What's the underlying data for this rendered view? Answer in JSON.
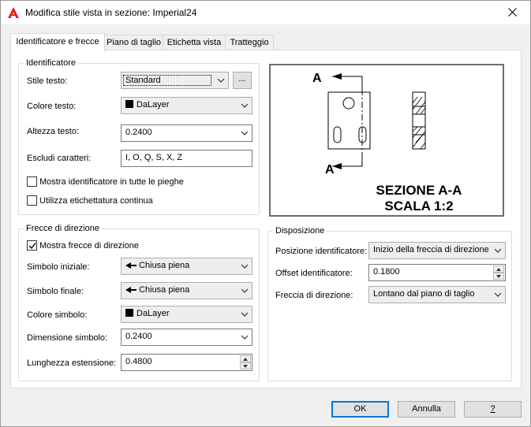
{
  "window": {
    "title": "Modifica stile vista in sezione: Imperial24"
  },
  "tabs": [
    {
      "label": "Identificatore e frecce"
    },
    {
      "label": "Piano di taglio"
    },
    {
      "label": "Etichetta vista"
    },
    {
      "label": "Tratteggio"
    }
  ],
  "identifier": {
    "group_title": "Identificatore",
    "text_style_label": "Stile testo:",
    "text_style_value": "Standard",
    "browse_label": "...",
    "text_color_label": "Colore testo:",
    "text_color_value": "DaLayer",
    "text_height_label": "Altezza testo:",
    "text_height_value": "0.2400",
    "exclude_label": "Escludi caratteri:",
    "exclude_value": "I, O, Q, S, X, Z",
    "show_all_bends_label": "Mostra identificatore in tutte le pieghe",
    "continuous_label": "Utilizza etichettatura continua"
  },
  "arrows": {
    "group_title": "Frecce di direzione",
    "show_arrows_label": "Mostra frecce di direzione",
    "start_symbol_label": "Simbolo iniziale:",
    "start_symbol_value": "Chiusa piena",
    "end_symbol_label": "Simbolo finale:",
    "end_symbol_value": "Chiusa piena",
    "symbol_color_label": "Colore simbolo:",
    "symbol_color_value": "DaLayer",
    "symbol_size_label": "Dimensione simbolo:",
    "symbol_size_value": "0.2400",
    "extension_label": "Lunghezza estensione:",
    "extension_value": "0.4800"
  },
  "layout": {
    "group_title": "Disposizione",
    "position_label": "Posizione identificatore:",
    "position_value": "Inizio della freccia di direzione",
    "offset_label": "Offset identificatore:",
    "offset_value": "0.1800",
    "direction_label": "Freccia di direzione:",
    "direction_value": "Lontano dal piano di taglio"
  },
  "preview": {
    "letter": "A",
    "caption_line1": "SEZIONE A-A",
    "caption_line2": "SCALA 1:2"
  },
  "buttons": {
    "ok": "OK",
    "cancel": "Annulla",
    "help": "?"
  },
  "colors": {
    "accent": "#0078d7",
    "app_icon": "#e1251b"
  }
}
